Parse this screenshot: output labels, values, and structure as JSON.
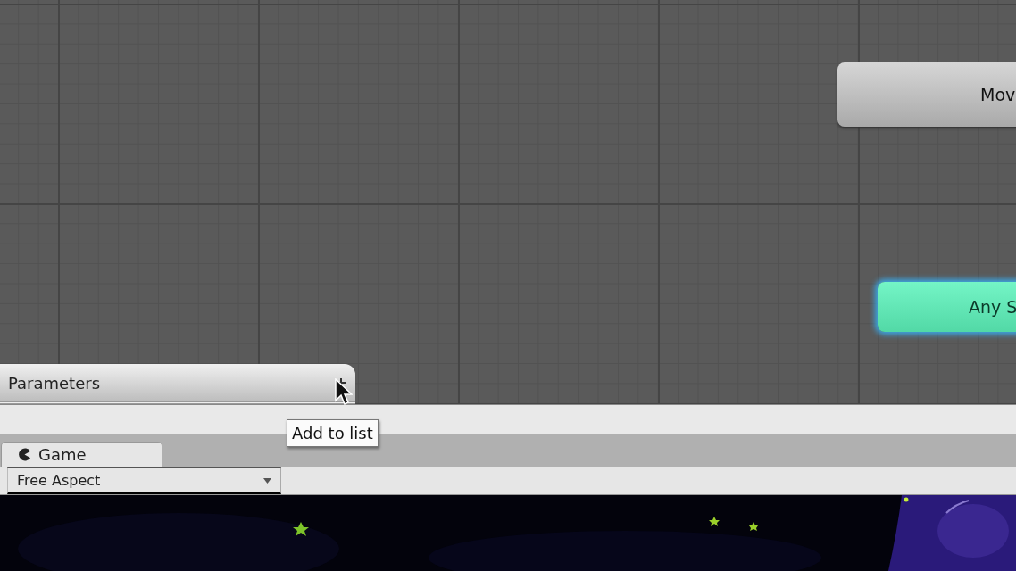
{
  "graph": {
    "states": [
      {
        "label": "Mov",
        "kind": "normal"
      },
      {
        "label": "Any S",
        "kind": "any"
      }
    ]
  },
  "parameters": {
    "title": "Parameters"
  },
  "tooltip": "Add to list",
  "tabs": [
    {
      "label": "Game",
      "selected": true
    }
  ],
  "aspect_dropdown": {
    "value": "Free Aspect"
  }
}
